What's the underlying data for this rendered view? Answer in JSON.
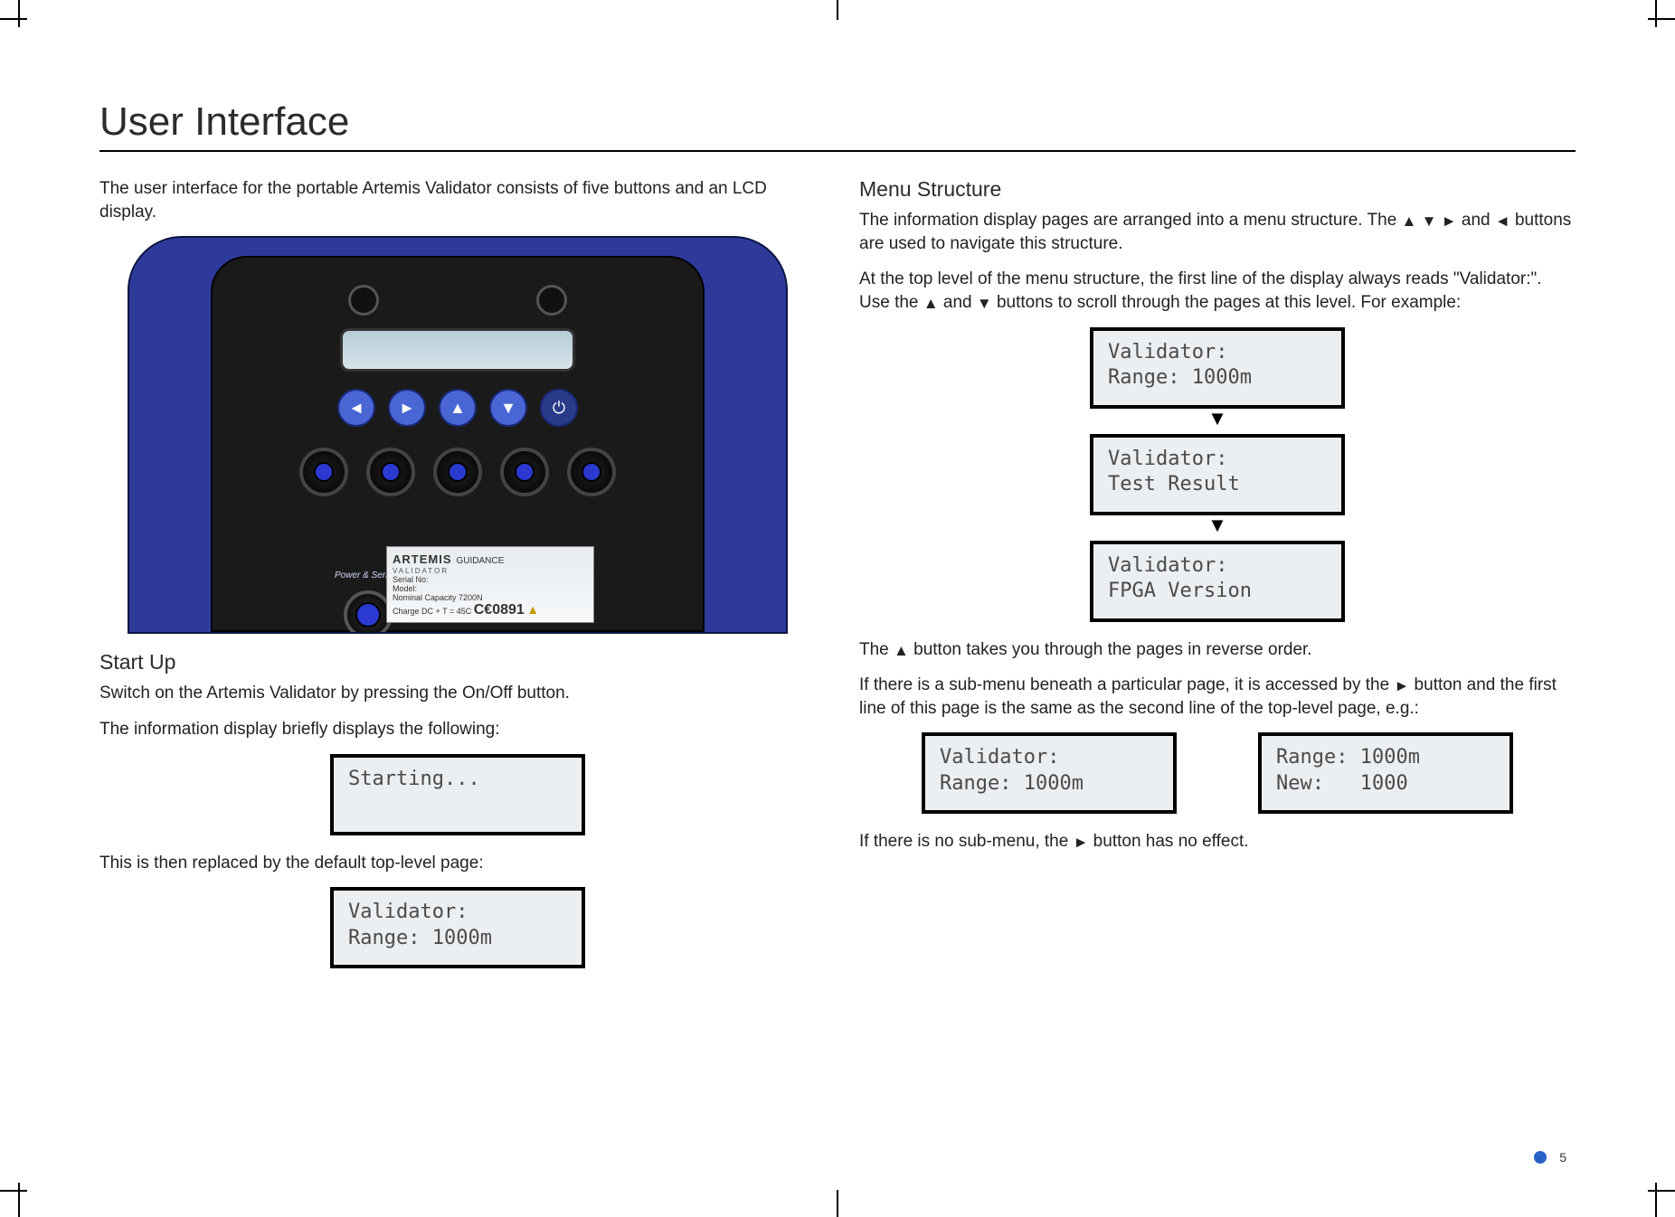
{
  "page": {
    "title": "User Interface",
    "number": "5"
  },
  "left": {
    "intro": "The user interface for the portable Artemis Validator consists of five buttons and an LCD display.",
    "startup_heading": "Start Up",
    "startup_p1": "Switch on the Artemis Validator by pressing the On/Off button.",
    "startup_p2": "The information display briefly displays the following:",
    "lcd_starting": "Starting...",
    "startup_p3": "This is then replaced by the default top-level page:",
    "lcd_default_line1": "Validator:",
    "lcd_default_line2": "Range: 1000m"
  },
  "right": {
    "menu_heading": "Menu Structure",
    "menu_p1_a": "The information display pages are arranged into a menu structure. The ",
    "menu_p1_b": " and ",
    "menu_p1_c": " buttons are used to navigate this structure.",
    "menu_p2_a": "At the top level of the menu structure, the first line of the display always reads \"Validator:\". Use the ",
    "menu_p2_b": " and ",
    "menu_p2_c": " buttons to scroll through the pages at this level. For example:",
    "flow": {
      "box1_l1": "Validator:",
      "box1_l2": "Range: 1000m",
      "box2_l1": "Validator:",
      "box2_l2": "Test Result",
      "box3_l1": "Validator:",
      "box3_l2": "FPGA Version"
    },
    "menu_p3_a": "The ",
    "menu_p3_b": " button takes you through the pages in reverse order.",
    "menu_p4_a": "If there is a sub-menu beneath a particular page, it is accessed by the ",
    "menu_p4_b": " button and the first line of this page is the same as the second line of the top-level page, e.g.:",
    "sbs": {
      "left_l1": "Validator:",
      "left_l2": "Range: 1000m",
      "right_l1": "Range: 1000m",
      "right_l2": "New:   1000"
    },
    "menu_p5_a": "If there is no sub-menu, the ",
    "menu_p5_b": " button has no effect."
  },
  "device": {
    "brand": "ARTEMIS",
    "brand_sub": "VALIDATOR",
    "cobrand": "GUIDANCE",
    "serial_label": "Serial No:",
    "model_label": "Model:",
    "cap_label": "Nominal Capacity 7200N",
    "temp_label": "Charge DC + T = 45C",
    "ce": "C€0891",
    "pwr_serial": "Power & Serial"
  },
  "glyphs": {
    "up": "▲",
    "down": "▼",
    "left": "◄",
    "right": "►"
  }
}
